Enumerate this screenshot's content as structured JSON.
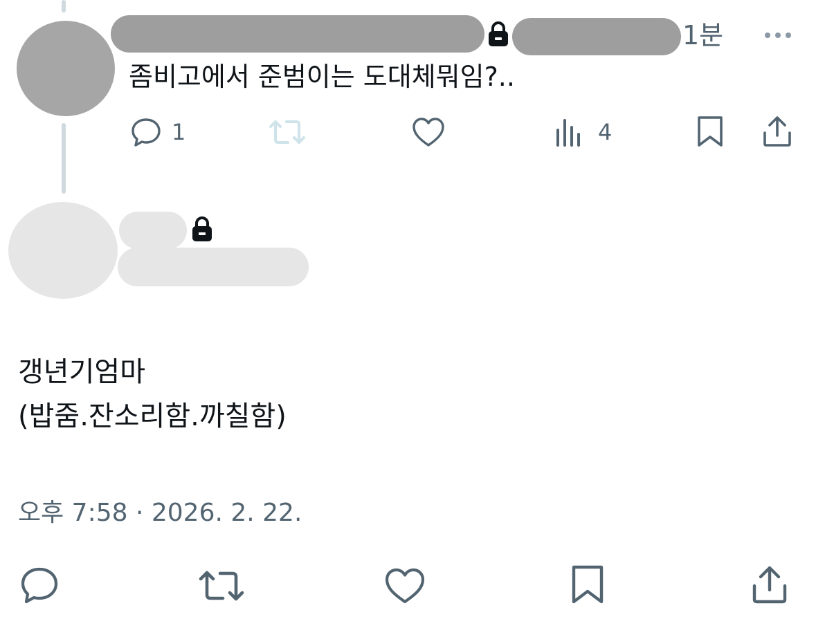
{
  "reply": {
    "time": "1분",
    "text": "좀비고에서 준범이는 도대체뭐임?..",
    "reply_count": "1",
    "view_count": "4",
    "icons": {
      "more": "more-icon",
      "lock": "lock-icon",
      "reply": "reply-icon",
      "retweet": "retweet-icon",
      "like": "heart-icon",
      "views": "views-icon",
      "bookmark": "bookmark-icon",
      "share": "share-icon"
    }
  },
  "post": {
    "text_line1": "갱년기엄마",
    "text_line2": "(밥줌.잔소리함.까칠함)",
    "timestamp": "오후 7:58 · 2026. 2. 22."
  },
  "colors": {
    "text": "#0f1419",
    "muted": "#536471",
    "thread_line": "#cfd9de",
    "redact_dark": "#9e9e9e",
    "redact_light": "#e6e6e6",
    "retweet_disabled": "#cfe3ea"
  }
}
